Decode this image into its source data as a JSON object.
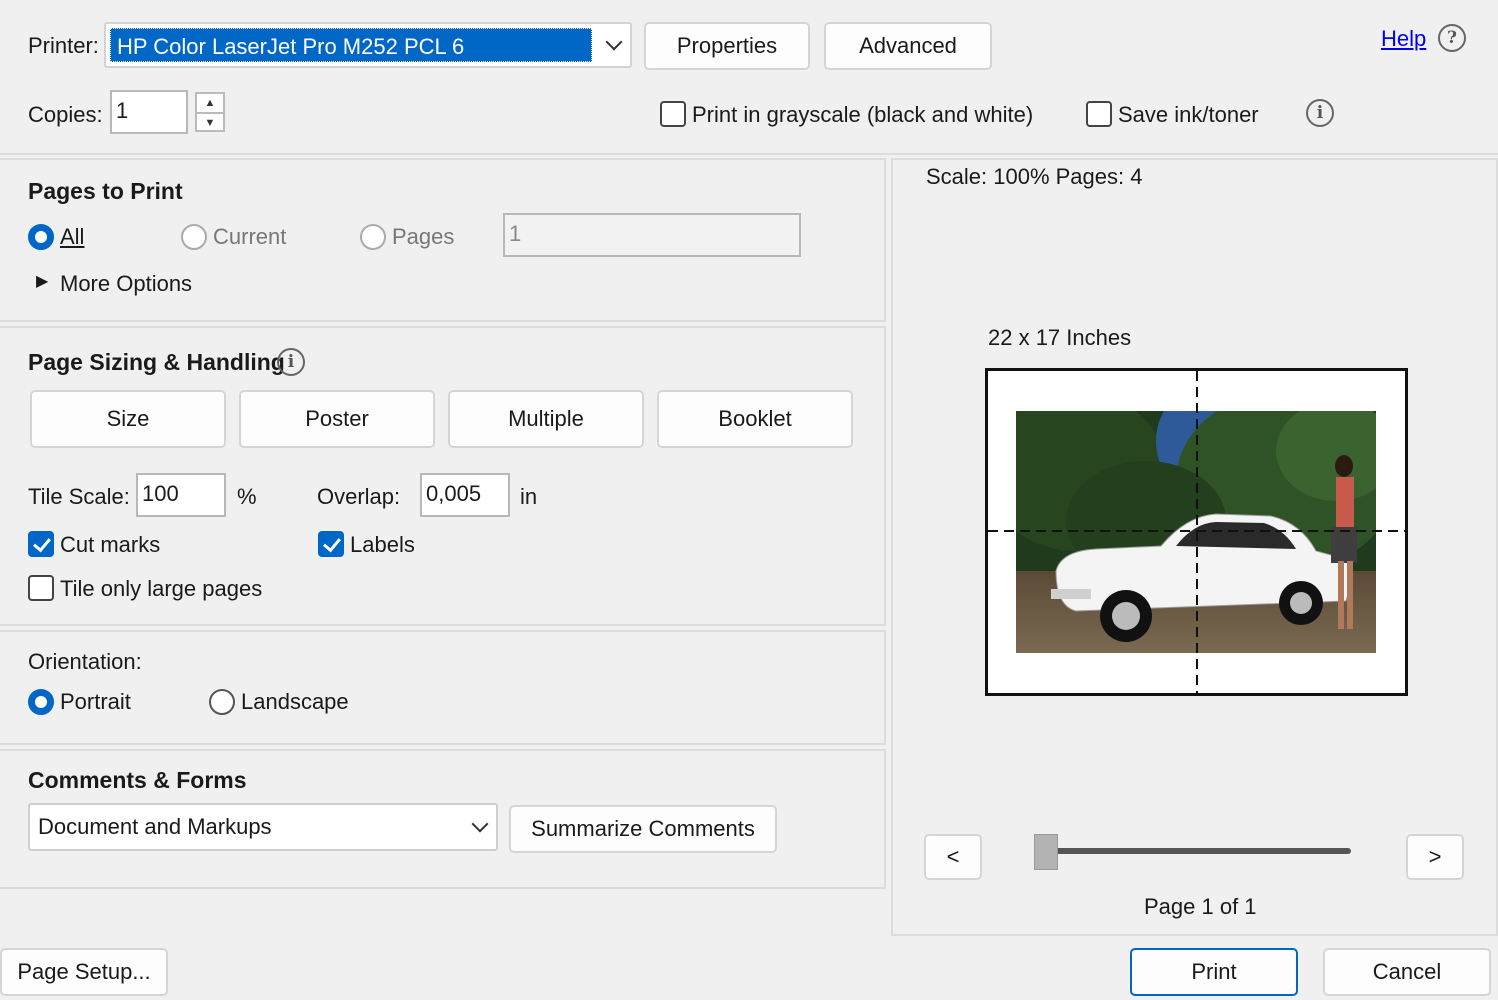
{
  "top": {
    "printer_label": "Printer:",
    "printer_value": "HP Color LaserJet Pro M252 PCL 6",
    "properties_label": "Properties",
    "advanced_label": "Advanced",
    "help_label": "Help",
    "help_icon": "?",
    "copies_label": "Copies:",
    "copies_value": "1",
    "grayscale_label": "Print in grayscale (black and white)",
    "grayscale_checked": false,
    "save_ink_label": "Save ink/toner",
    "save_ink_checked": false,
    "info_icon": "i"
  },
  "pages_to_print": {
    "title": "Pages to Print",
    "all_label": "All",
    "current_label": "Current",
    "pages_label": "Pages",
    "pages_value": "1",
    "selected": "All",
    "more_options_label": "More Options"
  },
  "page_sizing": {
    "title": "Page Sizing & Handling",
    "info_icon": "i",
    "tabs": [
      "Size",
      "Poster",
      "Multiple",
      "Booklet"
    ],
    "tile_scale_label": "Tile Scale:",
    "tile_scale_value": "100",
    "tile_scale_unit": "%",
    "overlap_label": "Overlap:",
    "overlap_value": "0,005",
    "overlap_unit": "in",
    "cut_marks_label": "Cut marks",
    "cut_marks_checked": true,
    "labels_label": "Labels",
    "labels_checked": true,
    "tile_large_label": "Tile only large pages",
    "tile_large_checked": false
  },
  "orientation": {
    "title": "Orientation:",
    "portrait_label": "Portrait",
    "landscape_label": "Landscape",
    "selected": "Portrait"
  },
  "comments_forms": {
    "title": "Comments & Forms",
    "dropdown_value": "Document and Markups",
    "summarize_label": "Summarize Comments"
  },
  "preview": {
    "scale_text": "Scale: 100% Pages: 4",
    "size_text": "22 x 17 Inches",
    "prev_label": "<",
    "next_label": ">",
    "page_indicator": "Page 1 of 1",
    "slider_position": 0
  },
  "footer": {
    "page_setup_label": "Page Setup...",
    "print_label": "Print",
    "cancel_label": "Cancel"
  }
}
